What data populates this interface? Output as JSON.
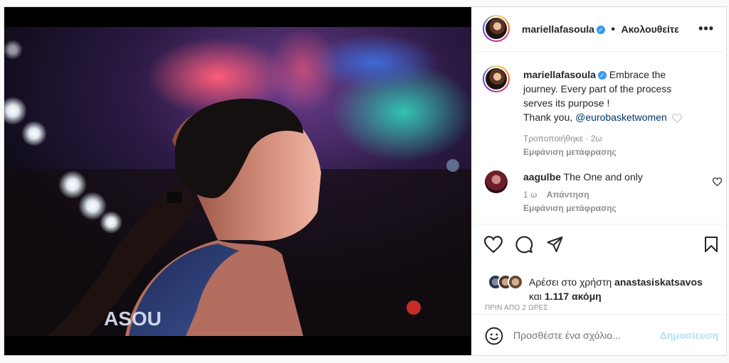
{
  "post": {
    "username": "mariellafasoula",
    "follow_label": "Ακολουθείτε",
    "caption": "Embrace the journey. Every part of the process serves its purpose !",
    "thanks_prefix": "Thank you, ",
    "mention": "@eurobasketwomen",
    "edited_label": "Τροποποιήθηκε · 2ω",
    "translate_label": "Εμφάνιση μετάφρασης",
    "jersey_text": "ASOU"
  },
  "comment": {
    "username": "aagulbe",
    "text": "The One and only",
    "age": "1 ω",
    "reply_label": "Απάντηση",
    "translate_label": "Εμφάνιση μετάφρασης"
  },
  "likes": {
    "prefix": "Αρέσει στο χρήστη",
    "user": "anastasiskatsavos",
    "and_label": "και",
    "count": "1.117 ακόμη"
  },
  "timestamp": "ΠΡΙΝ ΑΠΟ 2 ΩΡΕΣ",
  "composer": {
    "placeholder": "Προσθέστε ένα σχόλιο...",
    "publish_label": "Δημοσίευση"
  },
  "colors": {
    "verified": "#3897f0",
    "publish_disabled": "#b2dffc",
    "mention": "#00376b"
  }
}
